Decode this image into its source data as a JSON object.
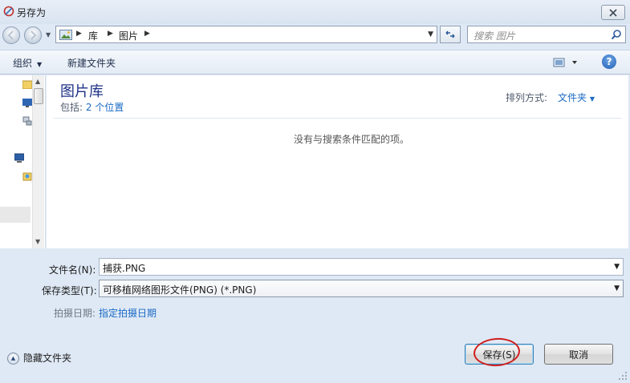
{
  "window": {
    "title": "另存为",
    "close_icon": "close-icon"
  },
  "address": {
    "crumbs": [
      "库",
      "图片"
    ],
    "search_placeholder": "搜索 图片"
  },
  "toolbar": {
    "organize_label": "组织",
    "new_folder_label": "新建文件夹"
  },
  "library": {
    "title": "图片库",
    "includes_label": "包括:",
    "includes_link": "2 个位置",
    "arrange_label": "排列方式:",
    "arrange_value": "文件夹",
    "empty_message": "没有与搜索条件匹配的项。"
  },
  "form": {
    "filename_label": "文件名(N):",
    "filename_value": "捕获.PNG",
    "filetype_label": "保存类型(T):",
    "filetype_value": "可移植网络图形文件(PNG) (*.PNG)",
    "date_label": "拍摄日期:",
    "date_link": "指定拍摄日期"
  },
  "footer": {
    "hide_folders_label": "隐藏文件夹",
    "save_label": "保存(S)",
    "cancel_label": "取消"
  },
  "colors": {
    "link": "#1a6ac4",
    "library_title": "#1e3287",
    "highlight_circle": "#d01e1e",
    "dialog_background": "#dfe9f5"
  }
}
